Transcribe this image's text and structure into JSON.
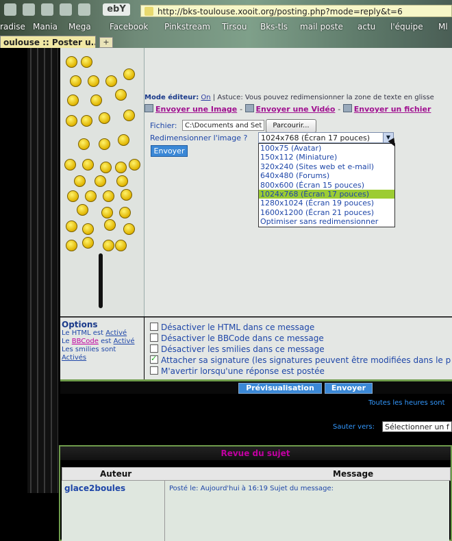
{
  "browser": {
    "url": "http://bks-toulouse.xooit.org/posting.php?mode=reply&t=6",
    "tab_title": "oulouse :: Poster u...",
    "new_tab": "+",
    "bookmarks": [
      "radise",
      "Mania",
      "Mega",
      "Facebook",
      "Pinkstream",
      "Tirsou",
      "Bks-tls",
      "mail poste",
      "actu",
      "l'équipe",
      "Ml"
    ]
  },
  "editor": {
    "mode_label": "Mode éditeur:",
    "mode_value": "On",
    "tip": "| Astuce: Vous pouvez redimensionner la zone de texte en glisse",
    "upload_image": "Envoyer une Image",
    "upload_video": "Envoyer une Vidéo",
    "upload_file": "Envoyer un fichier",
    "file_label": "Fichier:",
    "file_value": "C:\\Documents and Set",
    "browse_label": "Parcourir...",
    "resize_label": "Redimensionner l'image ?",
    "resize_selected": "1024x768 (Écran 17 pouces)",
    "resize_options": [
      "100x75 (Avatar)",
      "150x112 (Miniature)",
      "320x240 (Sites web et e-mail)",
      "640x480 (Forums)",
      "800x600 (Écran 15 pouces)",
      "1024x768 (Écran 17 pouces)",
      "1280x1024 (Écran 19 pouces)",
      "1600x1200 (Écran 21 pouces)",
      "Optimiser sans redimensionner"
    ],
    "selected_index": 5,
    "send_label": "Envoyer"
  },
  "options": {
    "title": "Options",
    "html_prefix": "Le HTML est",
    "html_value": "Activé",
    "bbcode_prefix": "Le",
    "bbcode_link": "BBCode",
    "bbcode_mid": "est",
    "bbcode_value": "Activé",
    "smilies_line": "Les smilies sont",
    "smilies_value": "Activés",
    "checkboxes": [
      {
        "label": "Désactiver le HTML dans ce message",
        "checked": false
      },
      {
        "label": "Désactiver le BBCode dans ce message",
        "checked": false
      },
      {
        "label": "Désactiver les smilies dans ce message",
        "checked": false
      },
      {
        "label": "Attacher sa signature (les signatures peuvent être modifiées dans le pr",
        "checked": true
      },
      {
        "label": "M'avertir lorsqu'une réponse est postée",
        "checked": false
      }
    ]
  },
  "actions": {
    "preview": "Prévisualisation",
    "submit": "Envoyer"
  },
  "footer": {
    "timezone": "Toutes les heures sont",
    "jump_label": "Sauter vers:",
    "jump_value": "Sélectionner un f"
  },
  "review": {
    "title": "Revue du sujet",
    "col_author": "Auteur",
    "col_message": "Message",
    "author": "glace2boules",
    "meta": "Posté le: Aujourd'hui à 16:19    Sujet du message:"
  }
}
